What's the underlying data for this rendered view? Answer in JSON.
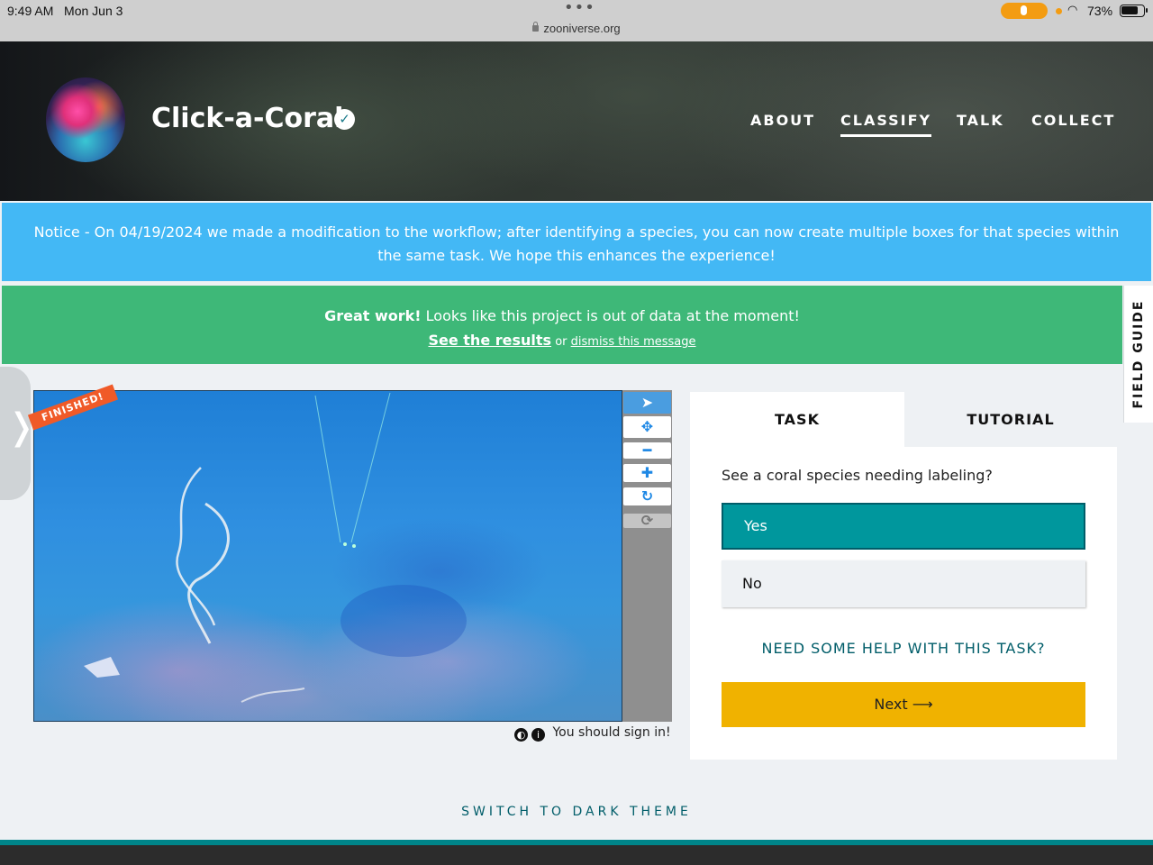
{
  "status_bar": {
    "time": "9:49 AM",
    "date": "Mon Jun 3",
    "dots": "•••",
    "url": "zooniverse.org",
    "battery": "73%",
    "wifi_icon": "wifi-icon",
    "mic_color": "#f39c12"
  },
  "header": {
    "project_title": "Click-a-Coral",
    "verified_icon": "check-badge-icon",
    "nav": [
      "ABOUT",
      "CLASSIFY",
      "TALK",
      "COLLECT"
    ],
    "active_nav": "CLASSIFY"
  },
  "notice": {
    "text": "Notice - On 04/19/2024 we made a modification to the workflow; after identifying a species, you can now create multiple boxes for that species within the same task. We hope this enhances the experience!",
    "color": "#43b8f5"
  },
  "out_of_data": {
    "bold": "Great work!",
    "text": " Looks like this project is out of data at the moment!",
    "results_link": "See the results",
    "or": " or ",
    "dismiss_link": "dismiss this message",
    "color": "#3eb878"
  },
  "field_guide": "FIELD GUIDE",
  "drawer_icon": "❭",
  "viewer": {
    "ribbon": "FINISHED!",
    "tools": [
      {
        "icon": "pointer-icon",
        "glyph": "➤"
      },
      {
        "icon": "move-icon",
        "glyph": "✥"
      },
      {
        "icon": "zoom-out-icon",
        "glyph": "━"
      },
      {
        "icon": "zoom-in-icon",
        "glyph": "✚"
      },
      {
        "icon": "rotate-icon",
        "glyph": "↻"
      },
      {
        "icon": "reset-icon",
        "glyph": "⟳"
      }
    ],
    "footer_text": "You should sign in!",
    "invert_icon": "◐",
    "info_icon": "i"
  },
  "task": {
    "tabs": [
      "TASK",
      "TUTORIAL"
    ],
    "question": "See a coral species needing labeling?",
    "answers": [
      "Yes",
      "No"
    ],
    "selected_answer": "Yes",
    "help": "NEED SOME HELP WITH THIS TASK?",
    "next_label": "Next",
    "next_icon": "arrow-right-icon",
    "next_glyph": "⟶",
    "accent": "#00979d",
    "next_color": "#f0b200"
  },
  "theme_toggle": "SWITCH TO DARK THEME"
}
